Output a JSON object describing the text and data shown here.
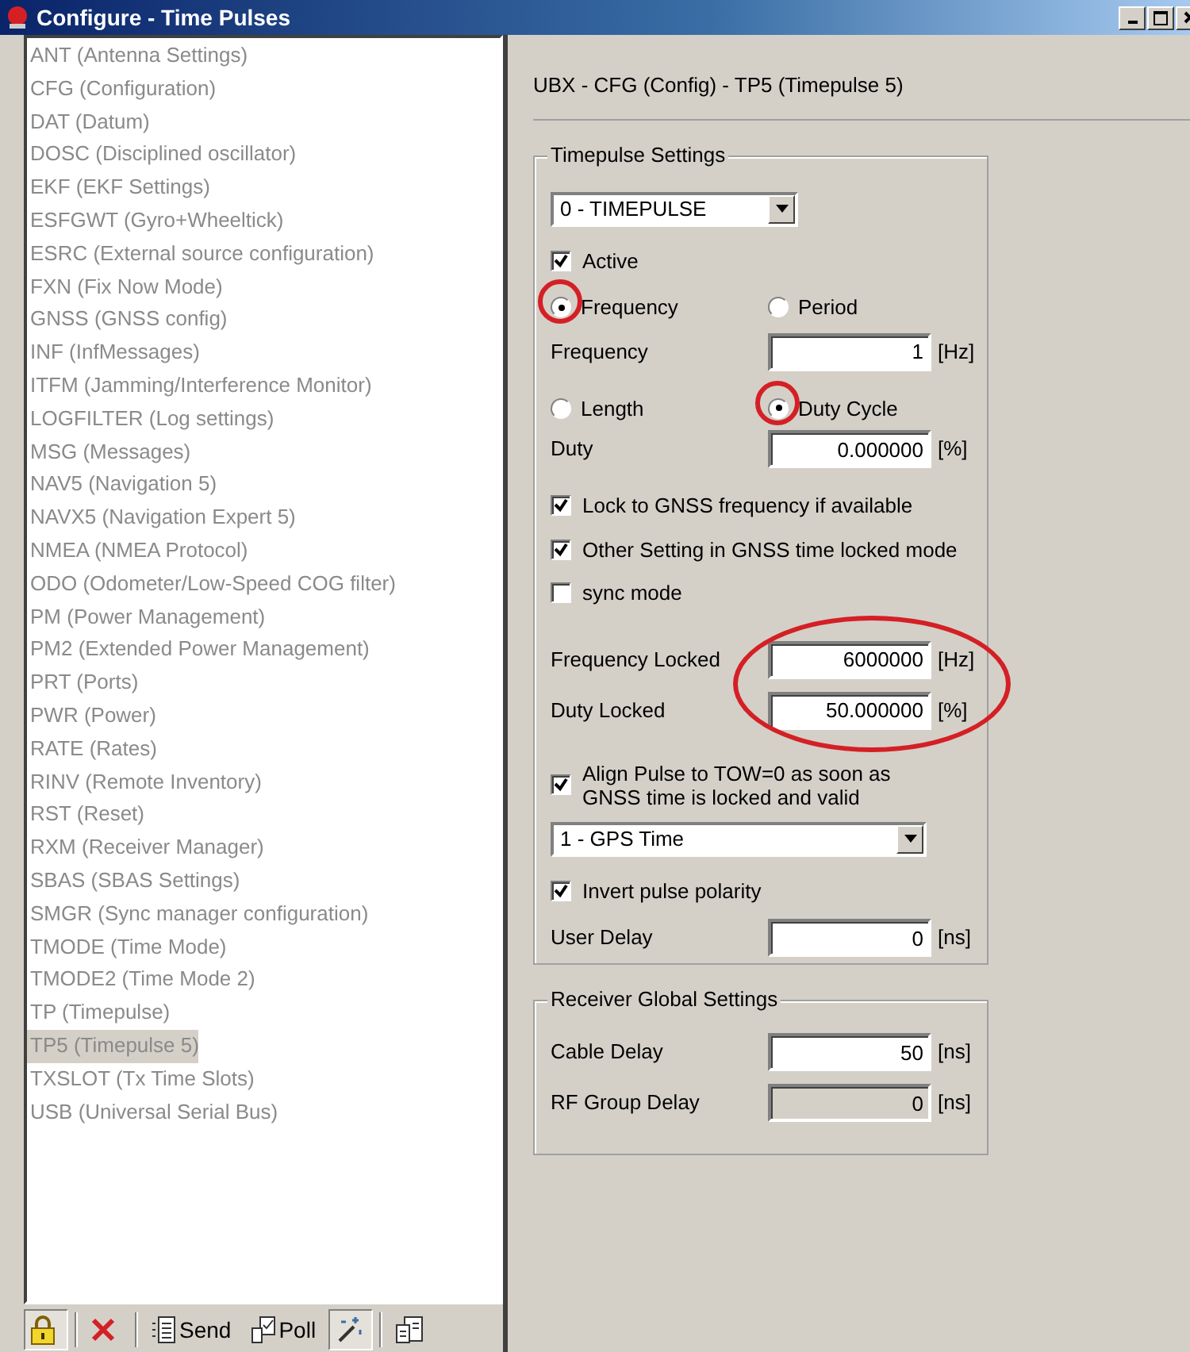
{
  "window": {
    "title": "Configure - Time Pulses"
  },
  "message_list": {
    "items": [
      {
        "label": "ANT (Antenna Settings)",
        "selected": false
      },
      {
        "label": "CFG (Configuration)",
        "selected": false
      },
      {
        "label": "DAT (Datum)",
        "selected": false
      },
      {
        "label": "DOSC (Disciplined oscillator)",
        "selected": false
      },
      {
        "label": "EKF (EKF Settings)",
        "selected": false
      },
      {
        "label": "ESFGWT (Gyro+Wheeltick)",
        "selected": false
      },
      {
        "label": "ESRC (External source configuration)",
        "selected": false
      },
      {
        "label": "FXN (Fix Now Mode)",
        "selected": false
      },
      {
        "label": "GNSS (GNSS config)",
        "selected": false
      },
      {
        "label": "INF (InfMessages)",
        "selected": false
      },
      {
        "label": "ITFM (Jamming/Interference Monitor)",
        "selected": false
      },
      {
        "label": "LOGFILTER (Log settings)",
        "selected": false
      },
      {
        "label": "MSG (Messages)",
        "selected": false
      },
      {
        "label": "NAV5 (Navigation 5)",
        "selected": false
      },
      {
        "label": "NAVX5 (Navigation Expert 5)",
        "selected": false
      },
      {
        "label": "NMEA (NMEA Protocol)",
        "selected": false
      },
      {
        "label": "ODO (Odometer/Low-Speed COG filter)",
        "selected": false
      },
      {
        "label": "PM (Power Management)",
        "selected": false
      },
      {
        "label": "PM2 (Extended Power Management)",
        "selected": false
      },
      {
        "label": "PRT (Ports)",
        "selected": false
      },
      {
        "label": "PWR (Power)",
        "selected": false
      },
      {
        "label": "RATE (Rates)",
        "selected": false
      },
      {
        "label": "RINV (Remote Inventory)",
        "selected": false
      },
      {
        "label": "RST (Reset)",
        "selected": false
      },
      {
        "label": "RXM (Receiver Manager)",
        "selected": false
      },
      {
        "label": "SBAS (SBAS Settings)",
        "selected": false
      },
      {
        "label": "SMGR (Sync manager configuration)",
        "selected": false
      },
      {
        "label": "TMODE (Time Mode)",
        "selected": false
      },
      {
        "label": "TMODE2 (Time Mode 2)",
        "selected": false
      },
      {
        "label": "TP (Timepulse)",
        "selected": false
      },
      {
        "label": "TP5 (Timepulse 5)",
        "selected": true
      },
      {
        "label": "TXSLOT (Tx Time Slots)",
        "selected": false
      },
      {
        "label": "USB (Universal Serial Bus)",
        "selected": false
      }
    ]
  },
  "toolbar": [
    {
      "kind": "lock",
      "pressed": true
    },
    {
      "kind": "delete",
      "pressed": false
    },
    {
      "kind": "send",
      "label": "Send",
      "pressed": false
    },
    {
      "kind": "poll",
      "label": "Poll",
      "pressed": false
    },
    {
      "kind": "wand",
      "pressed": true
    },
    {
      "kind": "document",
      "pressed": false
    }
  ],
  "panel": {
    "heading": "UBX - CFG (Config) - TP5 (Timepulse 5)",
    "timepulse_settings": {
      "legend": "Timepulse Settings",
      "pulse_select": {
        "value": "0 - TIMEPULSE"
      },
      "active": {
        "label": "Active",
        "checked": true
      },
      "frequency_mode": [
        {
          "label": "Frequency",
          "selected": true,
          "circled": true
        },
        {
          "label": "Period",
          "selected": false,
          "circled": false
        }
      ],
      "frequency": {
        "label": "Frequency",
        "value": "1",
        "unit": "[Hz]"
      },
      "length_mode": [
        {
          "label": "Length",
          "selected": false,
          "circled": false
        },
        {
          "label": "Duty Cycle",
          "selected": true,
          "circled": true
        }
      ],
      "duty": {
        "label": "Duty",
        "value": "0.000000",
        "unit": "[%]"
      },
      "options": [
        {
          "label": "Lock to GNSS frequency if available",
          "checked": true
        },
        {
          "label": "Other Setting in GNSS time locked mode",
          "checked": true
        },
        {
          "label": "sync mode",
          "checked": false
        }
      ],
      "locked_fields": {
        "circled": true,
        "fields": [
          {
            "label": "Frequency Locked",
            "value": "6000000",
            "unit": "[Hz]"
          },
          {
            "label": "Duty Locked",
            "value": "50.000000",
            "unit": "[%]"
          }
        ]
      },
      "align": {
        "label": "Align Pulse to TOW=0 as soon as GNSS time is locked and valid",
        "checked": true
      },
      "time_select": {
        "value": "1 - GPS Time"
      },
      "invert": {
        "label": "Invert pulse polarity",
        "checked": true
      },
      "user_delay": {
        "label": "User Delay",
        "value": "0",
        "unit": "[ns]"
      }
    },
    "receiver_global_settings": {
      "legend": "Receiver Global Settings",
      "fields": [
        {
          "label": "Cable Delay",
          "value": "50",
          "unit": "[ns]",
          "disabled": false
        },
        {
          "label": "RF Group Delay",
          "value": "0",
          "unit": "[ns]",
          "disabled": true
        }
      ]
    }
  }
}
